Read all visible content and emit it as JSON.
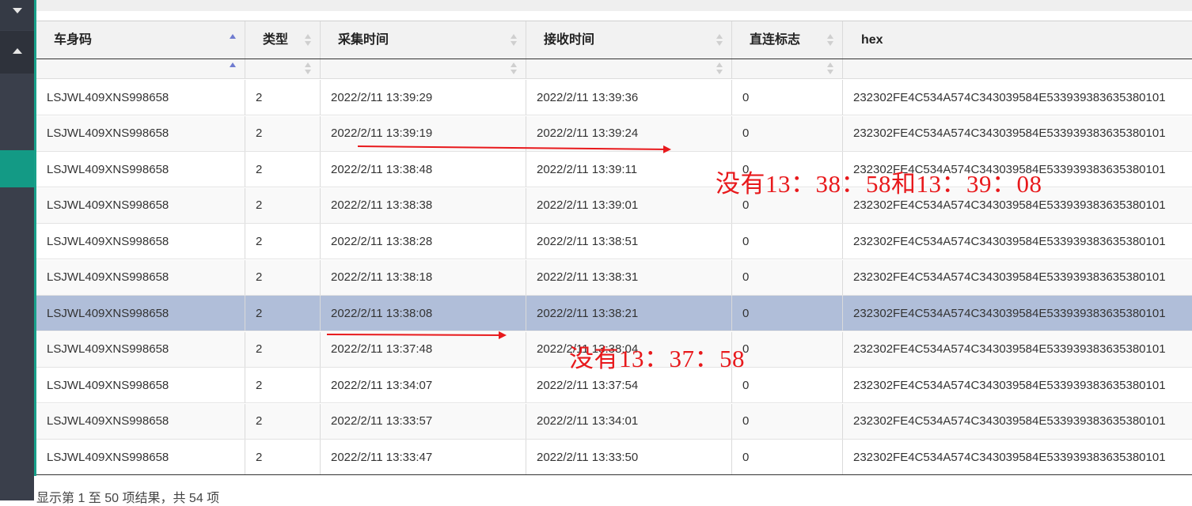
{
  "sidebar": {
    "collapse_icon": "chevron-down-icon",
    "expand_icon": "chevron-up-icon",
    "active_color": "#139a85"
  },
  "table": {
    "columns": [
      "车身码",
      "类型",
      "采集时间",
      "接收时间",
      "直连标志",
      "hex"
    ],
    "sorted_column": "车身码",
    "rows": [
      {
        "vin": "LSJWL409XNS998658",
        "type": "2",
        "collect_time": "2022/2/11 13:39:29",
        "receive_time": "2022/2/11 13:39:36",
        "direct_flag": "0",
        "hex": "232302FE4C534A574C343039584E533939383635380101"
      },
      {
        "vin": "LSJWL409XNS998658",
        "type": "2",
        "collect_time": "2022/2/11 13:39:19",
        "receive_time": "2022/2/11 13:39:24",
        "direct_flag": "0",
        "hex": "232302FE4C534A574C343039584E533939383635380101"
      },
      {
        "vin": "LSJWL409XNS998658",
        "type": "2",
        "collect_time": "2022/2/11 13:38:48",
        "receive_time": "2022/2/11 13:39:11",
        "direct_flag": "0",
        "hex": "232302FE4C534A574C343039584E533939383635380101"
      },
      {
        "vin": "LSJWL409XNS998658",
        "type": "2",
        "collect_time": "2022/2/11 13:38:38",
        "receive_time": "2022/2/11 13:39:01",
        "direct_flag": "0",
        "hex": "232302FE4C534A574C343039584E533939383635380101"
      },
      {
        "vin": "LSJWL409XNS998658",
        "type": "2",
        "collect_time": "2022/2/11 13:38:28",
        "receive_time": "2022/2/11 13:38:51",
        "direct_flag": "0",
        "hex": "232302FE4C534A574C343039584E533939383635380101"
      },
      {
        "vin": "LSJWL409XNS998658",
        "type": "2",
        "collect_time": "2022/2/11 13:38:18",
        "receive_time": "2022/2/11 13:38:31",
        "direct_flag": "0",
        "hex": "232302FE4C534A574C343039584E533939383635380101"
      },
      {
        "vin": "LSJWL409XNS998658",
        "type": "2",
        "collect_time": "2022/2/11 13:38:08",
        "receive_time": "2022/2/11 13:38:21",
        "direct_flag": "0",
        "hex": "232302FE4C534A574C343039584E533939383635380101",
        "selected": true
      },
      {
        "vin": "LSJWL409XNS998658",
        "type": "2",
        "collect_time": "2022/2/11 13:37:48",
        "receive_time": "2022/2/11 13:38:04",
        "direct_flag": "0",
        "hex": "232302FE4C534A574C343039584E533939383635380101"
      },
      {
        "vin": "LSJWL409XNS998658",
        "type": "2",
        "collect_time": "2022/2/11 13:34:07",
        "receive_time": "2022/2/11 13:37:54",
        "direct_flag": "0",
        "hex": "232302FE4C534A574C343039584E533939383635380101"
      },
      {
        "vin": "LSJWL409XNS998658",
        "type": "2",
        "collect_time": "2022/2/11 13:33:57",
        "receive_time": "2022/2/11 13:34:01",
        "direct_flag": "0",
        "hex": "232302FE4C534A574C343039584E533939383635380101"
      },
      {
        "vin": "LSJWL409XNS998658",
        "type": "2",
        "collect_time": "2022/2/11 13:33:47",
        "receive_time": "2022/2/11 13:33:50",
        "direct_flag": "0",
        "hex": "232302FE4C534A574C343039584E533939383635380101"
      }
    ]
  },
  "footer": {
    "summary": "显示第 1 至 50 项结果，共 54 项"
  },
  "annotations": {
    "note1": "没有13：38：58和13：39：08",
    "note2": "没有13：37：58",
    "color": "#e8191c"
  },
  "colors": {
    "selected_row": "#b0bed9",
    "accent": "#18a08a",
    "sort_active": "#6f7bd0"
  }
}
